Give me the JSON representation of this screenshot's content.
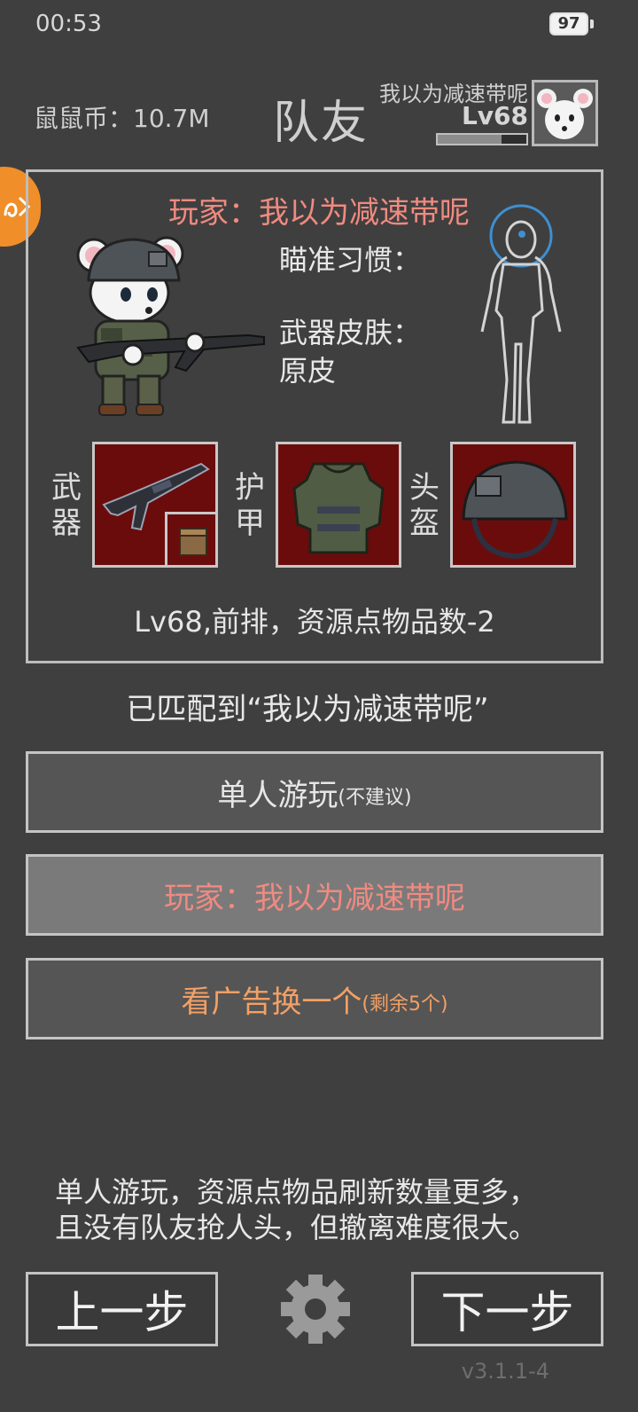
{
  "status_bar": {
    "time": "00:53",
    "battery": "97"
  },
  "header": {
    "coins_label": "鼠鼠币：10.7M",
    "title": "队友",
    "player_name": "我以为减速带呢",
    "player_level": "Lv68",
    "xp_progress": 0.72
  },
  "card": {
    "player_title": "玩家：我以为减速带呢",
    "aim_label": "瞄准习惯：",
    "skin_label": "武器皮肤：",
    "skin_value": "原皮",
    "weapon_label": "武器",
    "armor_label": "护甲",
    "helmet_label": "头盔",
    "summary": "Lv68,前排，资源点物品数-2"
  },
  "matched_text": "已匹配到“我以为减速带呢”",
  "buttons": {
    "solo_main": "单人游玩",
    "solo_note": "(不建议)",
    "teammate": "玩家：我以为减速带呢",
    "ad_main": "看广告换一个",
    "ad_note": "(剩余5个)"
  },
  "tip_line1": "单人游玩，资源点物品刷新数量更多，",
  "tip_line2": "且没有队友抢人头，但撤离难度很大。",
  "nav": {
    "prev": "上一步",
    "next": "下一步"
  },
  "version": "v3.1.1-4",
  "colors": {
    "background": "#3f3f3f",
    "player_name": "#f08a80",
    "ad_text": "#f3a065",
    "slot_bg": "#6a0c0c",
    "badge": "#f08f2a"
  },
  "icons": [
    "battery-icon",
    "mouse-avatar-icon",
    "side-badge-icon",
    "character-illustration",
    "body-outline-icon",
    "rifle-icon",
    "ammo-box-icon",
    "vest-icon",
    "helmet-icon",
    "gear-icon"
  ]
}
